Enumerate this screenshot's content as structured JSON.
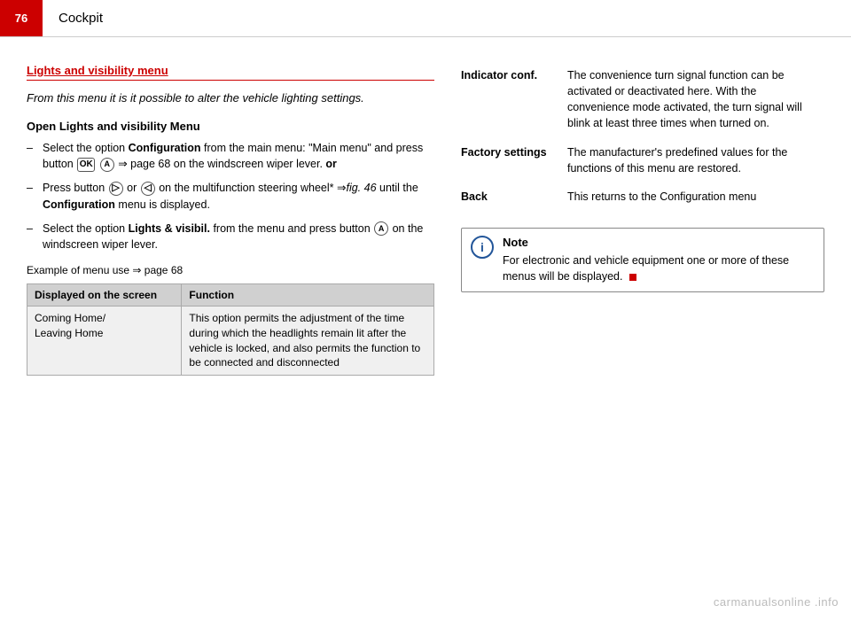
{
  "header": {
    "page_number": "76",
    "title": "Cockpit"
  },
  "left": {
    "section_heading": "Lights and visibility menu",
    "intro": "From this menu it is it possible to alter the vehicle lighting settings.",
    "open_heading": "Open Lights and visibility Menu",
    "bullets": [
      {
        "dash": "–",
        "parts": [
          {
            "text": "Select the option ",
            "bold": false
          },
          {
            "text": "Configuration",
            "bold": true
          },
          {
            "text": " from the main menu: \"Main menu\" and press button ",
            "bold": false
          },
          {
            "text": "OK",
            "bold": false,
            "type": "btn"
          },
          {
            "text": "A",
            "bold": false,
            "type": "circle"
          },
          {
            "text": " ⇒ page 68 on the windscreen wiper lever. ",
            "bold": false
          },
          {
            "text": "or",
            "bold": true
          }
        ]
      },
      {
        "dash": "–",
        "parts": [
          {
            "text": "Press button ",
            "bold": false
          },
          {
            "text": "▷",
            "bold": false,
            "type": "circle"
          },
          {
            "text": " or ",
            "bold": false
          },
          {
            "text": "◁",
            "bold": false,
            "type": "circle"
          },
          {
            "text": " on the multifunction steering wheel* ⇒",
            "bold": false
          },
          {
            "text": "fig. 46",
            "bold": false,
            "italic": true
          },
          {
            "text": " until the ",
            "bold": false
          },
          {
            "text": "Configuration",
            "bold": true
          },
          {
            "text": " menu is displayed.",
            "bold": false
          }
        ]
      },
      {
        "dash": "–",
        "parts": [
          {
            "text": "Select the option ",
            "bold": false
          },
          {
            "text": "Lights & visibil.",
            "bold": true
          },
          {
            "text": " from the menu and press button ",
            "bold": false
          },
          {
            "text": "A",
            "bold": false,
            "type": "circle"
          },
          {
            "text": " on the windscreen wiper lever.",
            "bold": false
          }
        ]
      }
    ],
    "example_text": "Example of menu use ⇒ page 68",
    "table": {
      "col1_header": "Displayed on the screen",
      "col2_header": "Function",
      "rows": [
        {
          "col1": "Coming Home/\nLeaving Home",
          "col2": "This option permits the adjustment of the time during which the headlights remain lit after the vehicle is locked, and also permits the function to be connected and disconnected"
        }
      ]
    }
  },
  "right": {
    "rows": [
      {
        "label": "Indicator conf.",
        "value": "The convenience turn signal function can be activated or deactivated here. With the convenience mode activated, the turn signal will blink at least three times when turned on."
      },
      {
        "label": "Factory settings",
        "value": "The manufacturer's predefined values for the functions of this menu are restored."
      },
      {
        "label": "Back",
        "value": "This returns to the Configuration menu"
      }
    ],
    "note": {
      "title": "Note",
      "icon": "i",
      "text": "For electronic and vehicle equipment one or more of these menus will be displayed."
    }
  },
  "watermark": "carmanualsonline .info"
}
